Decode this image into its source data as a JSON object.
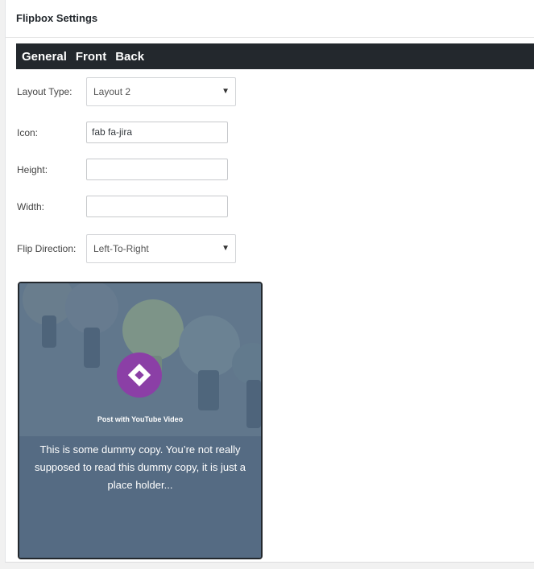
{
  "panel": {
    "title": "Flipbox Settings"
  },
  "tabs": [
    {
      "label": "General"
    },
    {
      "label": "Front"
    },
    {
      "label": "Back"
    }
  ],
  "fields": {
    "layout_type": {
      "label": "Layout Type:",
      "value": "Layout 2"
    },
    "icon": {
      "label": "Icon:",
      "value": "fab fa-jira"
    },
    "height": {
      "label": "Height:",
      "value": ""
    },
    "width": {
      "label": "Width:",
      "value": ""
    },
    "flip_direction": {
      "label": "Flip Direction:",
      "value": "Left-To-Right"
    }
  },
  "preview": {
    "title": "Post with YouTube Video",
    "text": "This is some dummy copy. You’re not really supposed to read this dummy copy, it is just a place holder...",
    "icon": "jira-icon",
    "icon_color": "#8b3fa6"
  }
}
